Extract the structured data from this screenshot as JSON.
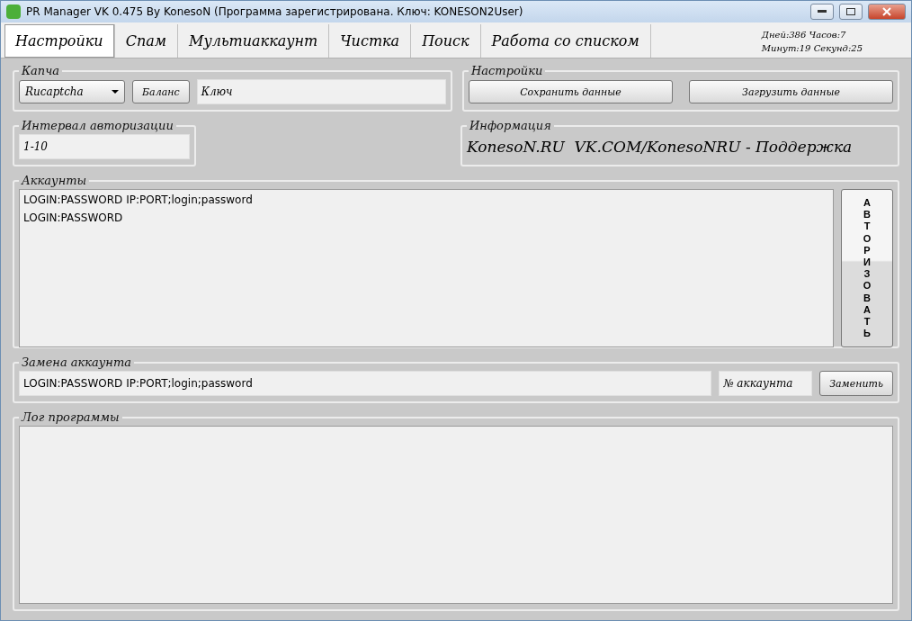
{
  "window": {
    "title": "PR Manager VK 0.475 By KonesoN (Программа зарегистрирована. Ключ: KONESON2User)"
  },
  "tabs": [
    {
      "label": "Настройки",
      "selected": true
    },
    {
      "label": "Спам",
      "selected": false
    },
    {
      "label": "Мультиаккаунт",
      "selected": false
    },
    {
      "label": "Чистка",
      "selected": false
    },
    {
      "label": "Поиск",
      "selected": false
    },
    {
      "label": "Работа со списком",
      "selected": false
    }
  ],
  "timer": [
    "Дней:386 Часов:7",
    "Минут:19 Секунд:25"
  ],
  "captcha": {
    "title": "Капча",
    "service": "Rucaptcha",
    "balance_button": "Баланс",
    "key": "Ключ"
  },
  "settings": {
    "title": "Настройки",
    "buttons": [
      "Сохранить данные",
      "Загрузить данные"
    ]
  },
  "auth_interval": {
    "title": "Интервал авторизации",
    "value": "1-10"
  },
  "info": {
    "title": "Информация",
    "text": "KonesoN.RU  VK.COM/KonesoNRU - Поддержка"
  },
  "accounts": {
    "title": "Аккаунты",
    "lines": [
      "LOGIN:PASSWORD IP:PORT;login;password",
      "LOGIN:PASSWORD"
    ],
    "authorize_button": "АВТОРИЗОВАТЬ"
  },
  "replace": {
    "title": "Замена аккаунта",
    "value": "LOGIN:PASSWORD IP:PORT;login;password",
    "number": "№ аккаунта",
    "button": "Заменить"
  },
  "log": {
    "title": "Лог программы"
  }
}
